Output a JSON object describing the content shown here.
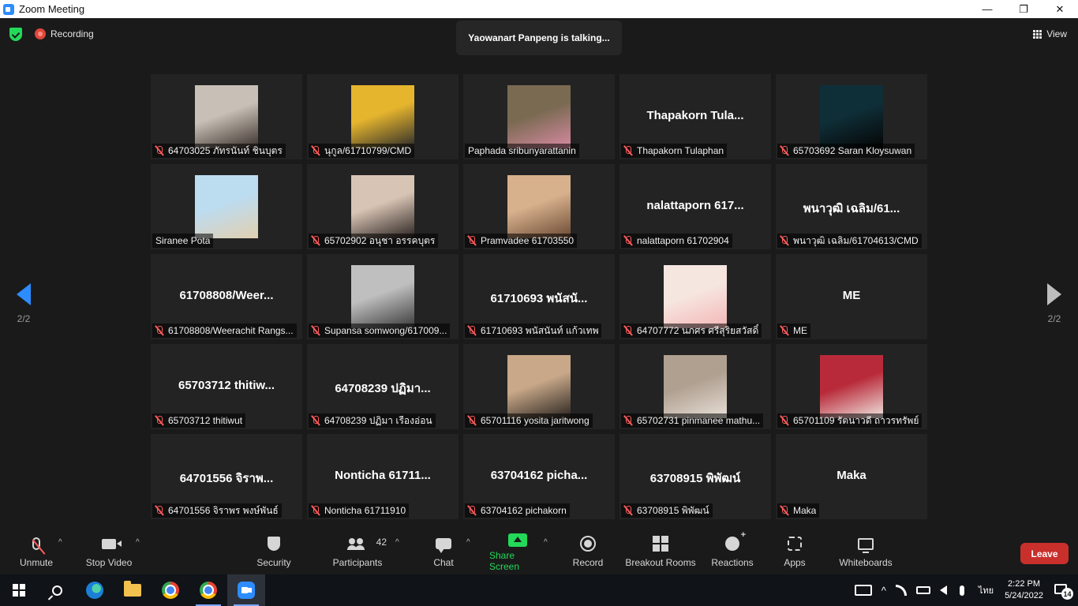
{
  "window": {
    "title": "Zoom Meeting",
    "minimize": "—",
    "maximize": "❐",
    "close": "✕"
  },
  "top": {
    "recording": "Recording",
    "talking": "Yaowanart Panpeng is talking...",
    "view": "View"
  },
  "pager": {
    "left_label": "2/2",
    "right_label": "2/2"
  },
  "tiles": [
    {
      "label": "64703025 ภัทรนันท์ ชินบุตร",
      "big": "",
      "muted": true,
      "photo": [
        "#c8c0b6",
        "#3a2f2a"
      ]
    },
    {
      "label": "นุกูล/61710799/CMD",
      "big": "",
      "muted": true,
      "photo": [
        "#e6b52e",
        "#2a2a2a"
      ]
    },
    {
      "label": "Paphada sribunyarattanin",
      "big": "",
      "muted": false,
      "photo": [
        "#7a6a52",
        "#d88aa2"
      ]
    },
    {
      "label": "Thapakorn Tulaphan",
      "big": "Thapakorn  Tula...",
      "muted": true,
      "photo": null
    },
    {
      "label": "65703692 Saran Kloysuwan",
      "big": "",
      "muted": true,
      "photo": [
        "#0f2f38",
        "#050505"
      ]
    },
    {
      "label": "Siranee Pota",
      "big": "",
      "muted": false,
      "photo": [
        "#bcdcf0",
        "#e2cfb0"
      ]
    },
    {
      "label": "65702902 อนุชา อรรคบุตร",
      "big": "",
      "muted": true,
      "photo": [
        "#d8c4b4",
        "#2a2220"
      ]
    },
    {
      "label": "Pramvadee 61703550",
      "big": "",
      "muted": true,
      "photo": [
        "#d7b08c",
        "#6b4a34"
      ]
    },
    {
      "label": "nalattaporn 61702904",
      "big": "nalattaporn  617...",
      "muted": true,
      "photo": null
    },
    {
      "label": "พนาวุฒิ เฉลิม/61704613/CMD",
      "big": "พนาวุฒิ เฉลิม/61...",
      "muted": true,
      "photo": null
    },
    {
      "label": "61708808/Weerachit Rangs...",
      "big": "61708808/Weer...",
      "muted": true,
      "photo": null
    },
    {
      "label": "Supansa somwong/617009...",
      "big": "",
      "muted": true,
      "photo": [
        "#bfbfbf",
        "#3a3a3a"
      ]
    },
    {
      "label": "61710693 พนัสนันท์ แก้วเทพ",
      "big": "61710693 พนัสนั...",
      "muted": true,
      "photo": null
    },
    {
      "label": "64707772 นภศร ศรีสุริยสวัสดิ์",
      "big": "",
      "muted": true,
      "photo": [
        "#f6e6e0",
        "#f4b6b6"
      ]
    },
    {
      "label": "ME",
      "big": "ME",
      "muted": true,
      "photo": null
    },
    {
      "label": "65703712 thitiwut",
      "big": "65703712 thitiw...",
      "muted": true,
      "photo": null
    },
    {
      "label": "64708239 ปฏิมา เรืองอ่อน",
      "big": "64708239 ปฏิมา...",
      "muted": true,
      "photo": null
    },
    {
      "label": "65701116 yosita jaritwong",
      "big": "",
      "muted": true,
      "photo": [
        "#c8a888",
        "#2a2420"
      ]
    },
    {
      "label": "65702731 pinmanee mathu...",
      "big": "",
      "muted": true,
      "photo": [
        "#b0a090",
        "#e8e0d8"
      ]
    },
    {
      "label": "65701109 รัตนาวดี ถาวรทรัพย์",
      "big": "",
      "muted": true,
      "photo": [
        "#b82a3a",
        "#f0e6e0"
      ]
    },
    {
      "label": "64701556 จิราพร พงษ์พันธ์",
      "big": "64701556 จิราพ...",
      "muted": true,
      "photo": null
    },
    {
      "label": "Nonticha 61711910",
      "big": "Nonticha 61711...",
      "muted": true,
      "photo": null
    },
    {
      "label": "63704162 pichakorn",
      "big": "63704162 picha...",
      "muted": true,
      "photo": null
    },
    {
      "label": "63708915 พิพัฒน์",
      "big": "63708915 พิพัฒน์",
      "muted": true,
      "photo": null
    },
    {
      "label": "Maka",
      "big": "Maka",
      "muted": true,
      "photo": null
    }
  ],
  "toolbar": {
    "unmute": "Unmute",
    "stop_video": "Stop Video",
    "security": "Security",
    "participants": "Participants",
    "participants_count": "42",
    "chat": "Chat",
    "share_screen": "Share Screen",
    "record": "Record",
    "breakout": "Breakout Rooms",
    "reactions": "Reactions",
    "apps": "Apps",
    "whiteboards": "Whiteboards",
    "leave": "Leave",
    "caret": "^"
  },
  "taskbar": {
    "ime": "ไทย",
    "time": "2:22 PM",
    "date": "5/24/2022",
    "notifications": "14",
    "chevron": "^"
  },
  "colors": {
    "accent": "#2d8cff",
    "share": "#23d959",
    "leave": "#c9302c",
    "muted": "#ff5b5b"
  }
}
